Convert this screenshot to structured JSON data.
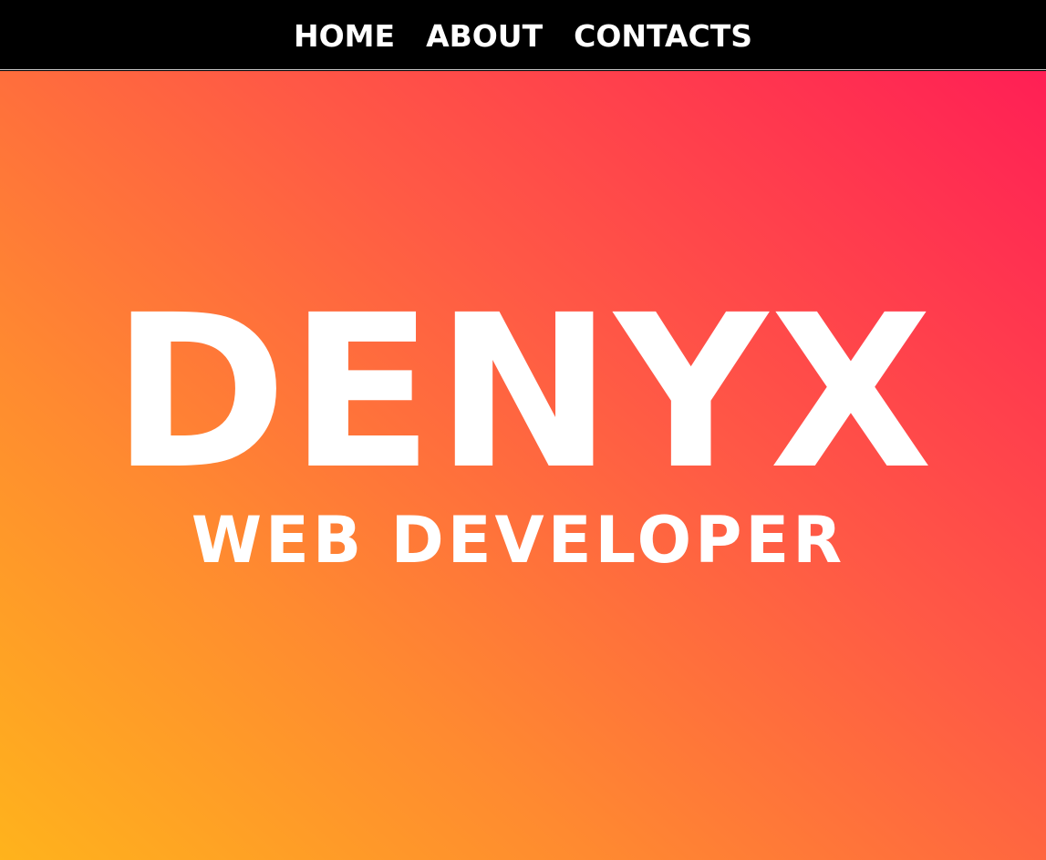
{
  "nav": {
    "items": [
      {
        "label": "HOME"
      },
      {
        "label": "ABOUT"
      },
      {
        "label": "CONTACTS"
      }
    ]
  },
  "hero": {
    "title": "DENYX",
    "subtitle": "WEB DEVELOPER"
  },
  "colors": {
    "navbar_background": "#000000",
    "text": "#ffffff",
    "gradient_start": "#ffb31c",
    "gradient_end": "#ff1f55"
  }
}
